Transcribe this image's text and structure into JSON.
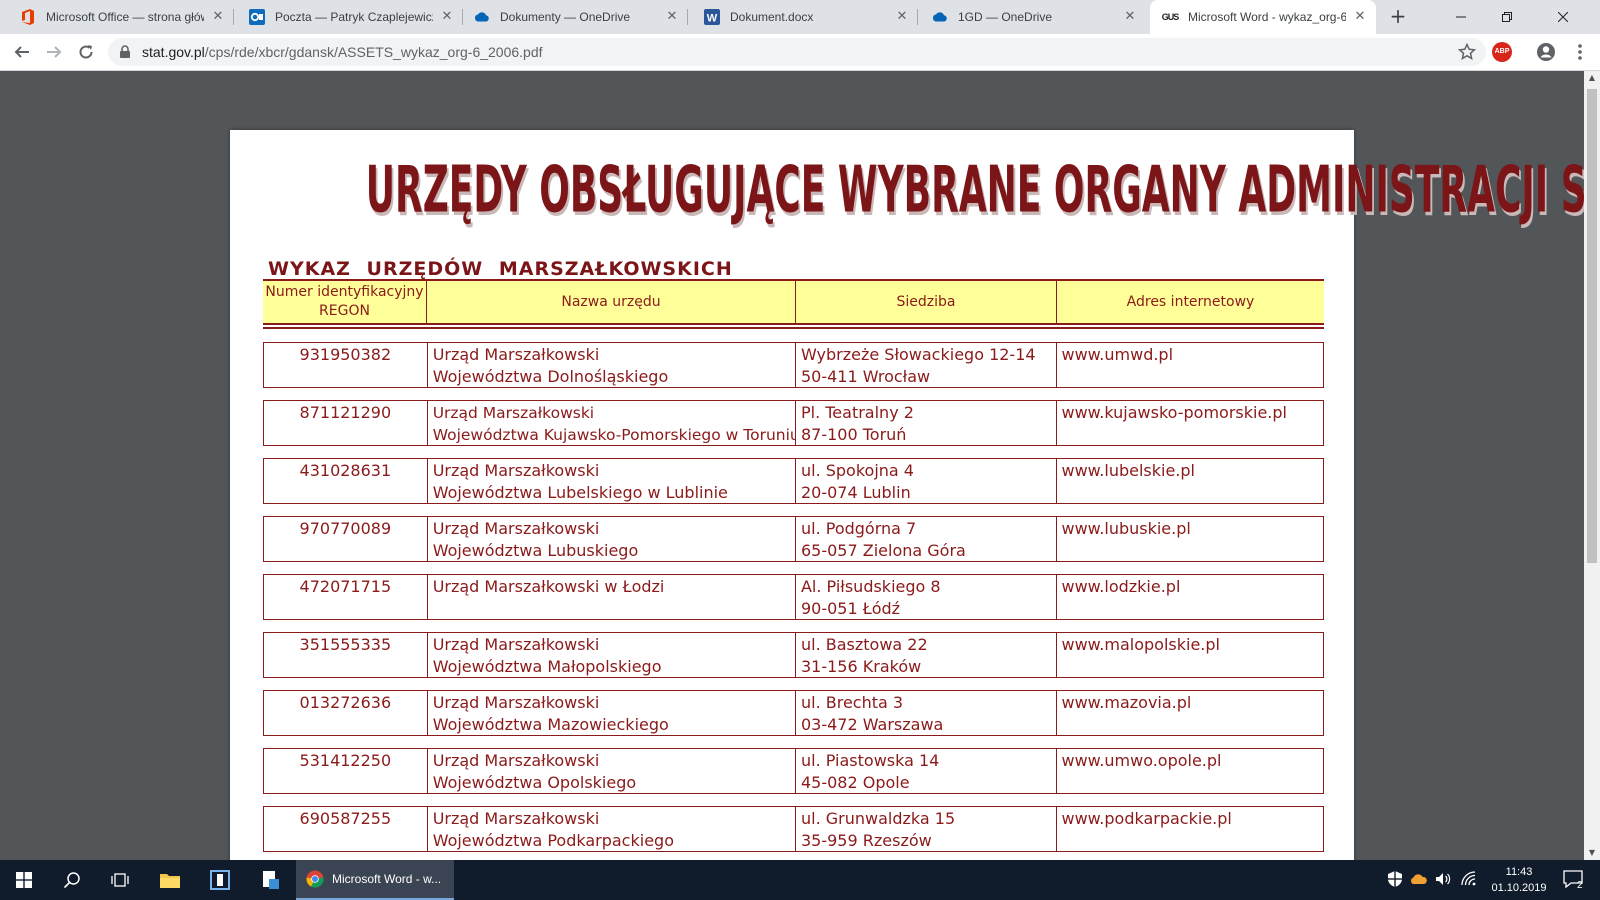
{
  "browser": {
    "tabs": [
      {
        "title": "Microsoft Office — strona głów",
        "icon": "office-icon",
        "active": false
      },
      {
        "title": "Poczta — Patryk Czaplejewicz -",
        "icon": "outlook-icon",
        "active": false
      },
      {
        "title": "Dokumenty — OneDrive",
        "icon": "onedrive-icon",
        "active": false
      },
      {
        "title": "Dokument.docx",
        "icon": "word-icon",
        "active": false
      },
      {
        "title": "1GD — OneDrive",
        "icon": "onedrive-icon",
        "active": false
      },
      {
        "title": "Microsoft Word - wykaz_org-6",
        "icon": "gus-icon",
        "active": true
      }
    ],
    "gus_favicon_text": "GUS",
    "url_host": "stat.gov.pl",
    "url_path": "/cps/rde/xbcr/gdansk/ASSETS_wykaz_org-6_2006.pdf",
    "abp_label": "ABP",
    "accent_color": "#1a73e8"
  },
  "document": {
    "title": "URZĘDY OBSŁUGUJĄCE WYBRANE ORGANY ADMINISTRACJI SAMORZĄDU TERYTORIALNEGO",
    "subtitle": "WYKAZ URZĘDÓW MARSZAŁKOWSKICH",
    "text_color": "#8b1a1a",
    "header_bg": "#ffff99",
    "headers": {
      "regon_line1": "Numer identyfikacyjny",
      "regon_line2": "REGON",
      "name": "Nazwa urzędu",
      "seat": "Siedziba",
      "web": "Adres internetowy"
    },
    "rows": [
      {
        "regon": "931950382",
        "name1": "Urząd Marszałkowski",
        "name2": "Województwa Dolnośląskiego",
        "addr1": "Wybrzeże Słowackiego 12-14",
        "addr2": "50-411 Wrocław",
        "web": "www.umwd.pl"
      },
      {
        "regon": "871121290",
        "name1": "Urząd Marszałkowski",
        "name2": "Województwa Kujawsko-Pomorskiego w Toruniu",
        "addr1": "Pl. Teatralny 2",
        "addr2": "87-100 Toruń",
        "web": "www.kujawsko-pomorskie.pl"
      },
      {
        "regon": "431028631",
        "name1": "Urząd Marszałkowski",
        "name2": "Województwa Lubelskiego w Lublinie",
        "addr1": "ul. Spokojna 4",
        "addr2": "20-074 Lublin",
        "web": "www.lubelskie.pl"
      },
      {
        "regon": "970770089",
        "name1": "Urząd Marszałkowski",
        "name2": "Województwa Lubuskiego",
        "addr1": "ul. Podgórna 7",
        "addr2": "65-057 Zielona Góra",
        "web": "www.lubuskie.pl"
      },
      {
        "regon": "472071715",
        "name1": "Urząd Marszałkowski w Łodzi",
        "name2": "",
        "addr1": "Al. Piłsudskiego 8",
        "addr2": "90-051 Łódź",
        "web": "www.lodzkie.pl"
      },
      {
        "regon": "351555335",
        "name1": "Urząd Marszałkowski",
        "name2": "Województwa Małopolskiego",
        "addr1": "ul. Basztowa 22",
        "addr2": "31-156 Kraków",
        "web": "www.malopolskie.pl"
      },
      {
        "regon": "013272636",
        "name1": "Urząd Marszałkowski",
        "name2": "Województwa Mazowieckiego",
        "addr1": "ul. Brechta 3",
        "addr2": "03-472 Warszawa",
        "web": "www.mazovia.pl"
      },
      {
        "regon": "531412250",
        "name1": "Urząd Marszałkowski",
        "name2": "Województwa Opolskiego",
        "addr1": "ul. Piastowska 14",
        "addr2": "45-082 Opole",
        "web": "www.umwo.opole.pl"
      },
      {
        "regon": "690587255",
        "name1": "Urząd Marszałkowski",
        "name2": "Województwa Podkarpackiego",
        "addr1": "ul. Grunwaldzka 15",
        "addr2": "35-959 Rzeszów",
        "web": "www.podkarpackie.pl"
      }
    ]
  },
  "taskbar": {
    "chrome_label": "Microsoft Word - w...",
    "time": "11:43",
    "date": "01.10.2019",
    "notification_count": "2"
  }
}
